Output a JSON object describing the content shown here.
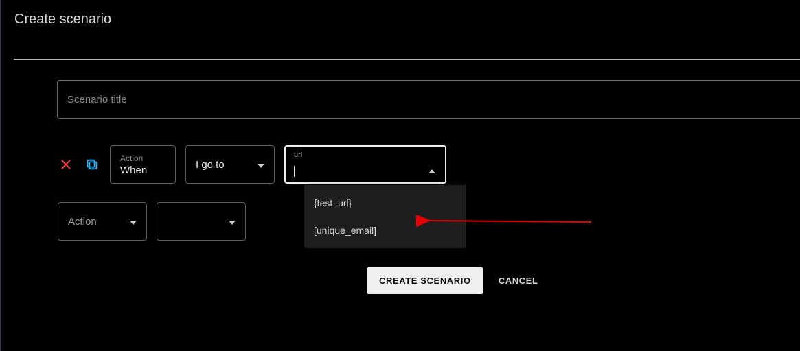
{
  "header": {
    "title": "Create scenario"
  },
  "form": {
    "title_placeholder": "Scenario title",
    "title_value": ""
  },
  "step1": {
    "action_label": "Action",
    "action_value": "When",
    "verb": "I go to",
    "url_label": "url",
    "url_value": "",
    "options": [
      "{test_url}",
      "[unique_email]"
    ]
  },
  "step2": {
    "action_placeholder": "Action"
  },
  "buttons": {
    "create": "CREATE SCENARIO",
    "cancel": "CANCEL"
  },
  "colors": {
    "delete_icon": "#f44336",
    "copy_icon": "#29b6f6",
    "annotation_arrow": "#e50000"
  }
}
